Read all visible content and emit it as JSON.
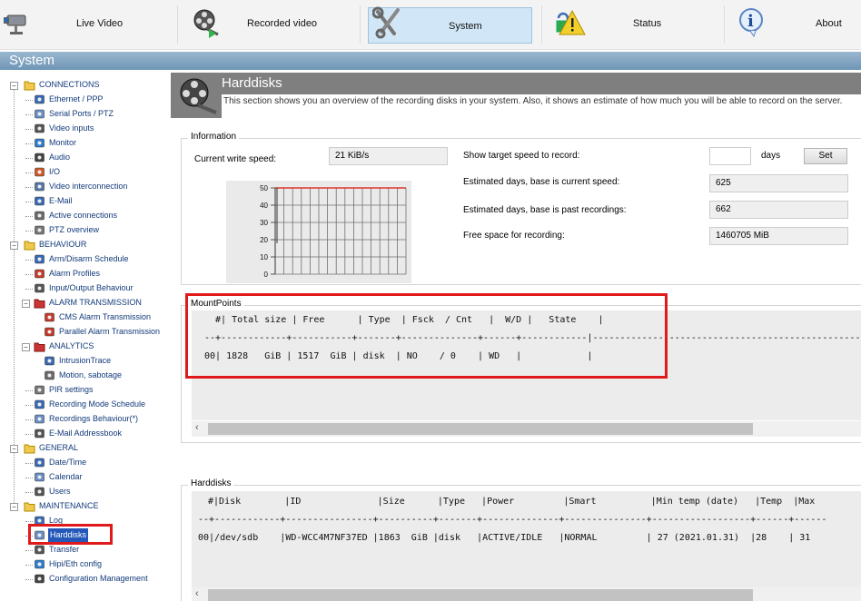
{
  "nav": {
    "items": [
      {
        "label": "Live Video",
        "icon": "camera-icon"
      },
      {
        "label": "Recorded video",
        "icon": "film-reel-icon"
      },
      {
        "label": "System",
        "icon": "wrench-icon",
        "active": true
      },
      {
        "label": "Status",
        "icon": "warning-lock-icon"
      },
      {
        "label": "About",
        "icon": "info-icon"
      }
    ]
  },
  "window_title": "System",
  "sidebar": {
    "groups": [
      {
        "label": "CONNECTIONS",
        "items": [
          "Ethernet / PPP",
          "Serial Ports / PTZ",
          "Video inputs",
          "Monitor",
          "Audio",
          "I/O",
          "Video interconnection",
          "E-Mail",
          "Active connections",
          "PTZ overview"
        ]
      },
      {
        "label": "BEHAVIOUR",
        "items": [
          "Arm/Disarm Schedule",
          "Alarm Profiles",
          "Input/Output Behaviour",
          "ALARM TRANSMISSION",
          "CMS Alarm Transmission",
          "Parallel Alarm Transmission",
          "ANALYTICS",
          "IntrusionTrace",
          "Motion, sabotage",
          "PIR settings",
          "Recording Mode Schedule",
          "Recordings Behaviour(*)",
          "E-Mail Addressbook"
        ]
      },
      {
        "label": "GENERAL",
        "items": [
          "Date/Time",
          "Calendar",
          "Users"
        ]
      },
      {
        "label": "MAINTENANCE",
        "items": [
          "Log",
          "Harddisks",
          "Transfer",
          "Hipi/Eth config",
          "Configuration Management"
        ]
      }
    ],
    "selected": "Harddisks"
  },
  "page": {
    "title": "Harddisks",
    "description": "This section shows you an overview of the recording disks in your system. Also, it shows an estimate of how much you will be able to record on the server."
  },
  "information": {
    "legend": "Information",
    "write_speed_label": "Current write speed:",
    "write_speed_value": "21 KiB/s",
    "target_speed_label": "Show target speed to record:",
    "target_speed_value": "",
    "days_label": "days",
    "set_label": "Set",
    "est_current_label": "Estimated days, base is current speed:",
    "est_current_value": "625",
    "est_past_label": "Estimated days, base is past recordings:",
    "est_past_value": "662",
    "free_space_label": "Free space for recording:",
    "free_space_value": "1460705 MiB"
  },
  "chart_data": {
    "type": "line",
    "title": "",
    "yticks": [
      "50",
      "40",
      "30",
      "20",
      "10",
      "0"
    ],
    "ylim": [
      0,
      50
    ],
    "series": [
      {
        "values": [
          50,
          50,
          50,
          50,
          50,
          50,
          50,
          50,
          50,
          50,
          50
        ]
      }
    ]
  },
  "mountpoints": {
    "legend": "MountPoints",
    "header": "  #| Total size | Free      | Type  | Fsck  / Cnt   |  W/D |   State    |",
    "separator": "--+------------+-----------+-------+--------------+------+------------|-----------------------------------------------------",
    "rows": [
      "00| 1828   GiB | 1517  GiB | disk  | NO    / 0    | WD   |            |"
    ]
  },
  "harddisks": {
    "legend": "Harddisks",
    "header": " #|Disk        |ID              |Size      |Type   |Power         |Smart          |Min temp (date)   |Temp  |Max",
    "separator": "--+------------+----------------+----------+-------+--------------+---------------+------------------+------+------",
    "rows": [
      "00|/dev/sdb    |WD-WCC4M7NF37ED |1863  GiB |disk   |ACTIVE/IDLE   |NORMAL         | 27 (2021.01.31)  |28    | 31"
    ]
  },
  "colors": {
    "highlight_red": "#e01a1a",
    "selected_blue": "#2458b8",
    "tab_active": "#d1e7f7"
  }
}
